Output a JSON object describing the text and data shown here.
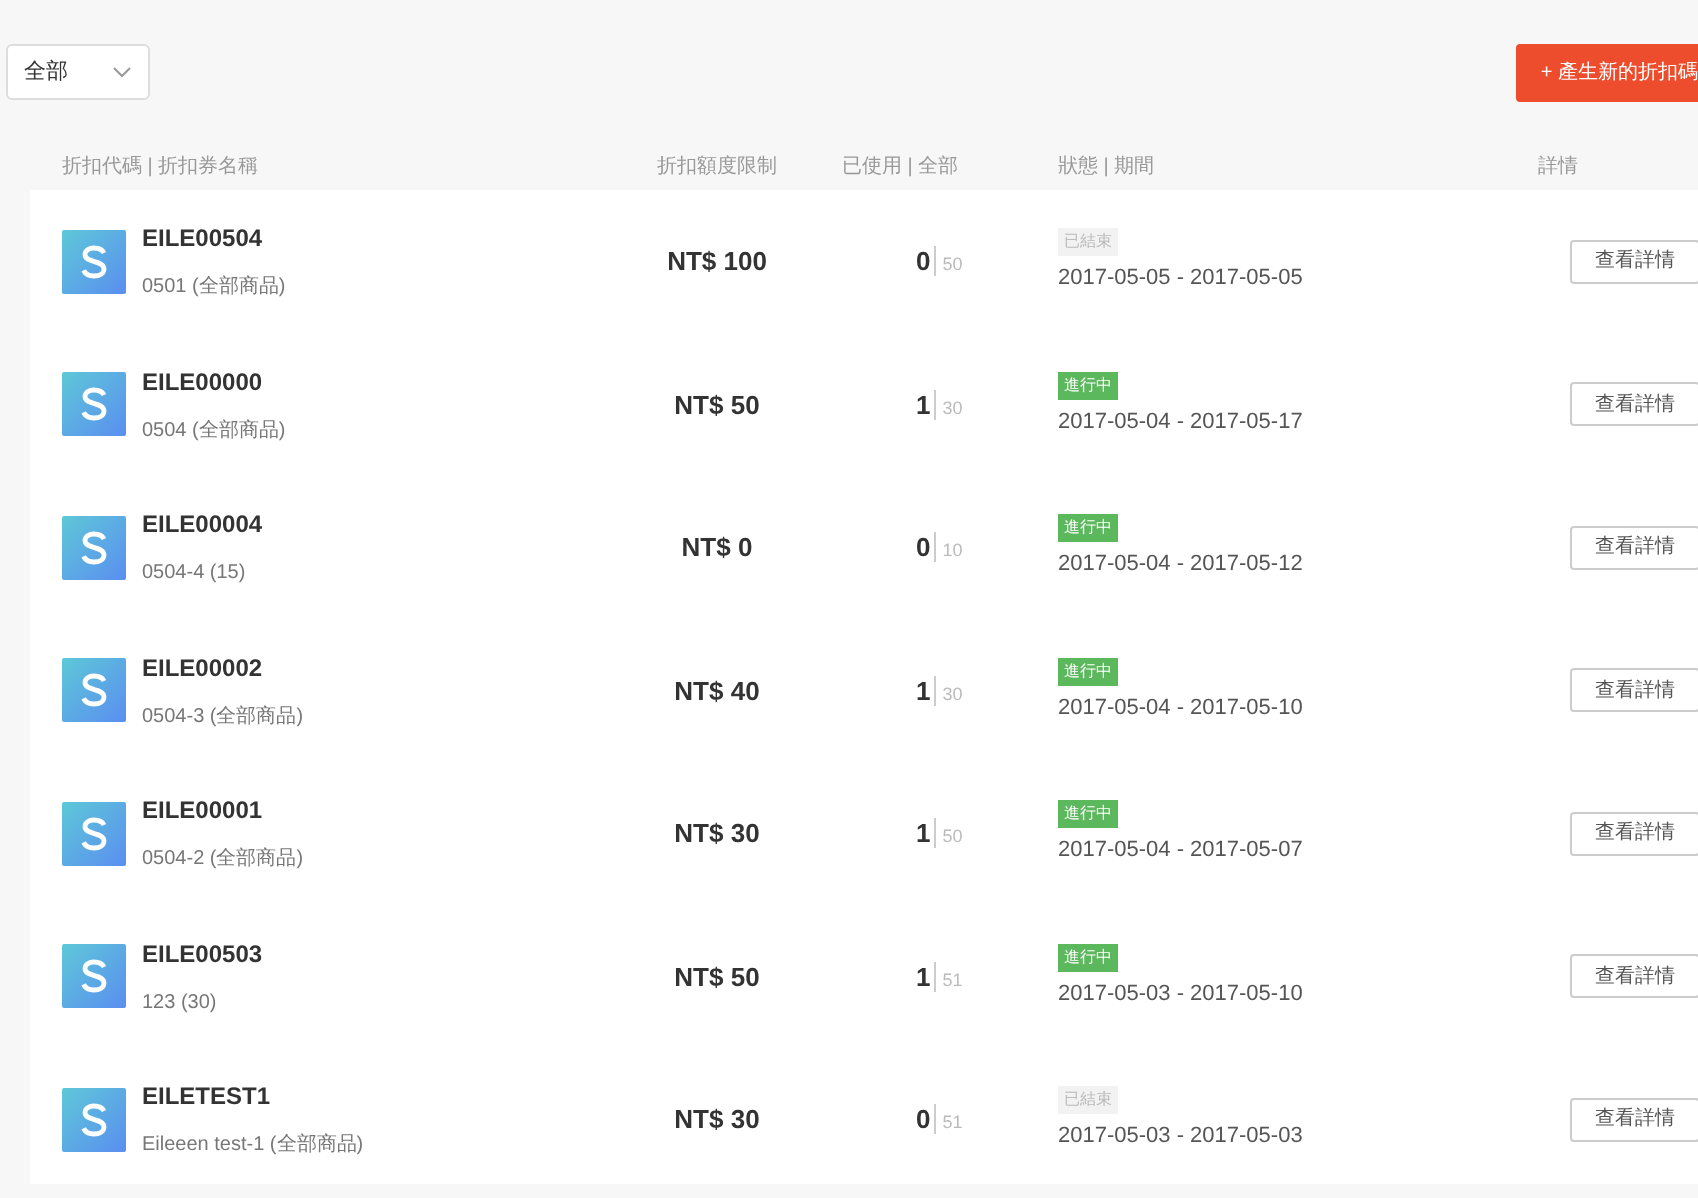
{
  "filter": {
    "value": "全部"
  },
  "create_button": {
    "label": "+ 產生新的折扣碼"
  },
  "table": {
    "columns": [
      "折扣代碼 | 折扣券名稱",
      "折扣額度限制",
      "已使用 | 全部",
      "狀態 | 期間",
      "詳情"
    ],
    "rows": [
      {
        "code": "EILE00504",
        "name": "0501 (全部商品)",
        "amount": "NT$ 100",
        "used": "0",
        "total": "50",
        "status": {
          "kind": "ended",
          "label": "已結束"
        },
        "period": "2017-05-05 - 2017-05-05",
        "action": "查看詳情"
      },
      {
        "code": "EILE00000",
        "name": "0504 (全部商品)",
        "amount": "NT$ 50",
        "used": "1",
        "total": "30",
        "status": {
          "kind": "active",
          "label": "進行中"
        },
        "period": "2017-05-04 - 2017-05-17",
        "action": "查看詳情"
      },
      {
        "code": "EILE00004",
        "name": "0504-4 (15)",
        "amount": "NT$ 0",
        "used": "0",
        "total": "10",
        "status": {
          "kind": "active",
          "label": "進行中"
        },
        "period": "2017-05-04 - 2017-05-12",
        "action": "查看詳情"
      },
      {
        "code": "EILE00002",
        "name": "0504-3 (全部商品)",
        "amount": "NT$ 40",
        "used": "1",
        "total": "30",
        "status": {
          "kind": "active",
          "label": "進行中"
        },
        "period": "2017-05-04 - 2017-05-10",
        "action": "查看詳情"
      },
      {
        "code": "EILE00001",
        "name": "0504-2 (全部商品)",
        "amount": "NT$ 30",
        "used": "1",
        "total": "50",
        "status": {
          "kind": "active",
          "label": "進行中"
        },
        "period": "2017-05-04 - 2017-05-07",
        "action": "查看詳情"
      },
      {
        "code": "EILE00503",
        "name": "123 (30)",
        "amount": "NT$ 50",
        "used": "1",
        "total": "51",
        "status": {
          "kind": "active",
          "label": "進行中"
        },
        "period": "2017-05-03 - 2017-05-10",
        "action": "查看詳情"
      },
      {
        "code": "EILETEST1",
        "name": "Eileeen test-1 (全部商品)",
        "amount": "NT$ 30",
        "used": "0",
        "total": "51",
        "status": {
          "kind": "ended",
          "label": "已結束"
        },
        "period": "2017-05-03 - 2017-05-03",
        "action": "查看詳情"
      }
    ]
  }
}
